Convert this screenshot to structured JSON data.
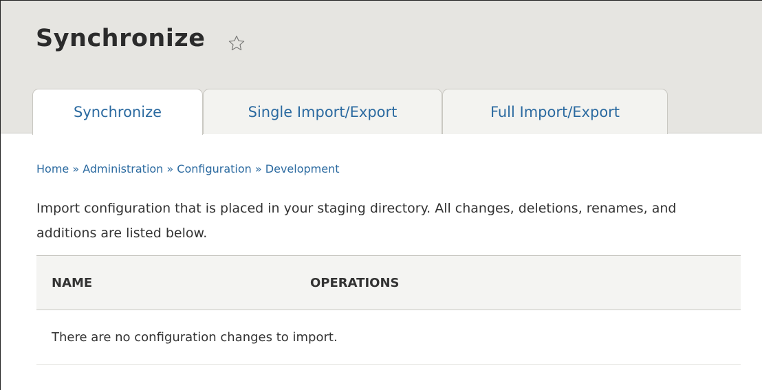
{
  "header": {
    "title": "Synchronize",
    "favorite_icon": "star-outline-icon"
  },
  "tabs": [
    {
      "label": "Synchronize",
      "active": true
    },
    {
      "label": "Single Import/Export",
      "active": false
    },
    {
      "label": "Full Import/Export",
      "active": false
    }
  ],
  "breadcrumb": {
    "items": [
      "Home",
      "Administration",
      "Configuration",
      "Development"
    ],
    "separator": "»"
  },
  "description": "Import configuration that is placed in your staging directory. All changes, deletions, renames, and additions are listed below.",
  "table": {
    "columns": [
      "NAME",
      "OPERATIONS"
    ],
    "empty_message": "There are no configuration changes to import."
  },
  "colors": {
    "link": "#2b6aa0",
    "header_bg": "#e6e5e1",
    "text": "#333333"
  }
}
